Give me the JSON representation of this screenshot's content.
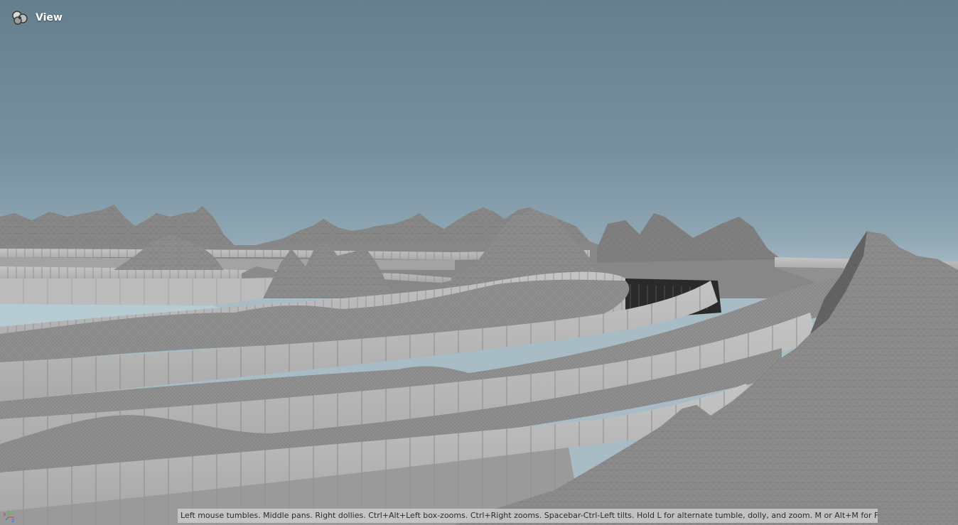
{
  "viewport": {
    "title": "View",
    "title_icon": "camera-cluster-icon",
    "hint_text": "Left mouse tumbles. Middle pans. Right dollies. Ctrl+Alt+Left box-zooms. Ctrl+Right zooms. Spacebar-Ctrl-Left tilts. Hold L for alternate tumble, dolly, and zoom. M or Alt+M for First Person Navigation.",
    "axis": {
      "x_label": "x",
      "y_label": "y",
      "z_label": "z",
      "x_color": "#e23c3c",
      "y_color": "#3ccf3c",
      "z_color": "#3c6ee2"
    },
    "colors": {
      "sky_top": "#657f8e",
      "sky_horizon": "#a8bcc6",
      "terrain": "#8a8a8a",
      "wall": "#b9b9b9",
      "ground_water": "#b7cbd3"
    }
  }
}
